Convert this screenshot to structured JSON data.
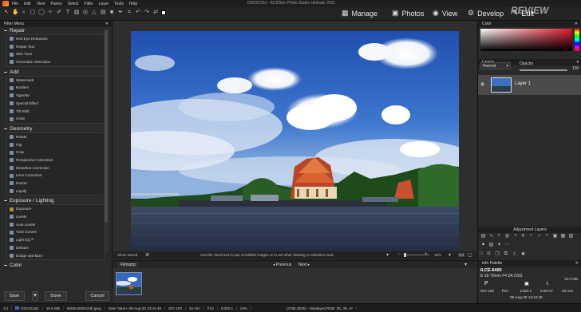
{
  "window_title": "DSC01261 - ACDSee Photo Studio Ultimate 2021",
  "menu": [
    "File",
    "Edit",
    "View",
    "Panes",
    "Select",
    "Filter",
    "Layer",
    "Tools",
    "Help"
  ],
  "modes": [
    {
      "icon": "grid-icon",
      "label": "Manage"
    },
    {
      "icon": "photo-icon",
      "label": "Photos"
    },
    {
      "icon": "eye-icon",
      "label": "View"
    },
    {
      "icon": "develop-icon",
      "label": "Develop"
    },
    {
      "icon": "edit-icon",
      "label": "Edit"
    }
  ],
  "watermark": "REVIEW",
  "filter_menu": {
    "title": "Filter Menu",
    "sections": [
      {
        "title": "Repair",
        "items": [
          "Red Eye Reduction",
          "Repair Tool",
          "Skin Tune",
          "Chromatic Aberration"
        ]
      },
      {
        "title": "Add",
        "items": [
          "Watermark",
          "Borders",
          "Vignette",
          "Special Effect",
          "Tilt-Shift",
          "Grain"
        ]
      },
      {
        "title": "Geometry",
        "items": [
          "Rotate",
          "Flip",
          "Crop",
          "Perspective Correction",
          "Distortion Correction",
          "Lens Correction",
          "Resize",
          "Liquify"
        ]
      },
      {
        "title": "Exposure / Lighting",
        "items": [
          "Exposure",
          "Levels",
          "Auto Levels",
          "Tone Curves",
          "Light EQ™",
          "Dehaze",
          "Dodge and Burn"
        ]
      },
      {
        "title": "Color",
        "items": []
      }
    ],
    "buttons": {
      "save": "Save",
      "done": "Done",
      "cancel": "Cancel"
    }
  },
  "canvas": {
    "show_saved": "Show Saved",
    "hint": "Use the Hand tool to pan scrollable images or to set other drawing or selection tools",
    "zoom": "18%",
    "ratio": "1:1"
  },
  "filmstrip": {
    "title": "Filmstrip",
    "previous": "Previous",
    "next": "Next"
  },
  "color_panel": {
    "title": "Color"
  },
  "layers_panel": {
    "title": "Layers",
    "blend_mode": "Normal",
    "opacity_label": "Opacity",
    "opacity_value": "100",
    "layers": [
      {
        "name": "Layer 1"
      }
    ]
  },
  "adjustment_layers": {
    "title": "Adjustment Layers"
  },
  "info_palette": {
    "title": "Info Palette",
    "camera": "ILCE-6400",
    "lens": "E 16-70mm F4 ZA OSS",
    "mode": "P",
    "file_size": "15.6 MB",
    "iso": "ISO 100",
    "aperture": "f/10",
    "shutter": "1/320 s",
    "ev": "0.00 eV",
    "focal": "23 mm",
    "date": "08-Aug-20 13:44:49"
  },
  "statusbar": {
    "index": "1/1",
    "filename": "DSC01261",
    "size": "15.6 MB",
    "dims": "6000x4000x24b jpeg",
    "date_taken": "Date Taken: 08-Aug-20 13:44:49",
    "iso": "ISO 100",
    "focal": "34 mm",
    "aperture": "f/10",
    "shutter": "1/320 s",
    "zoom": "18%",
    "coords": "(4796,3835) - Displayed RGB: 35, 39, 47"
  }
}
